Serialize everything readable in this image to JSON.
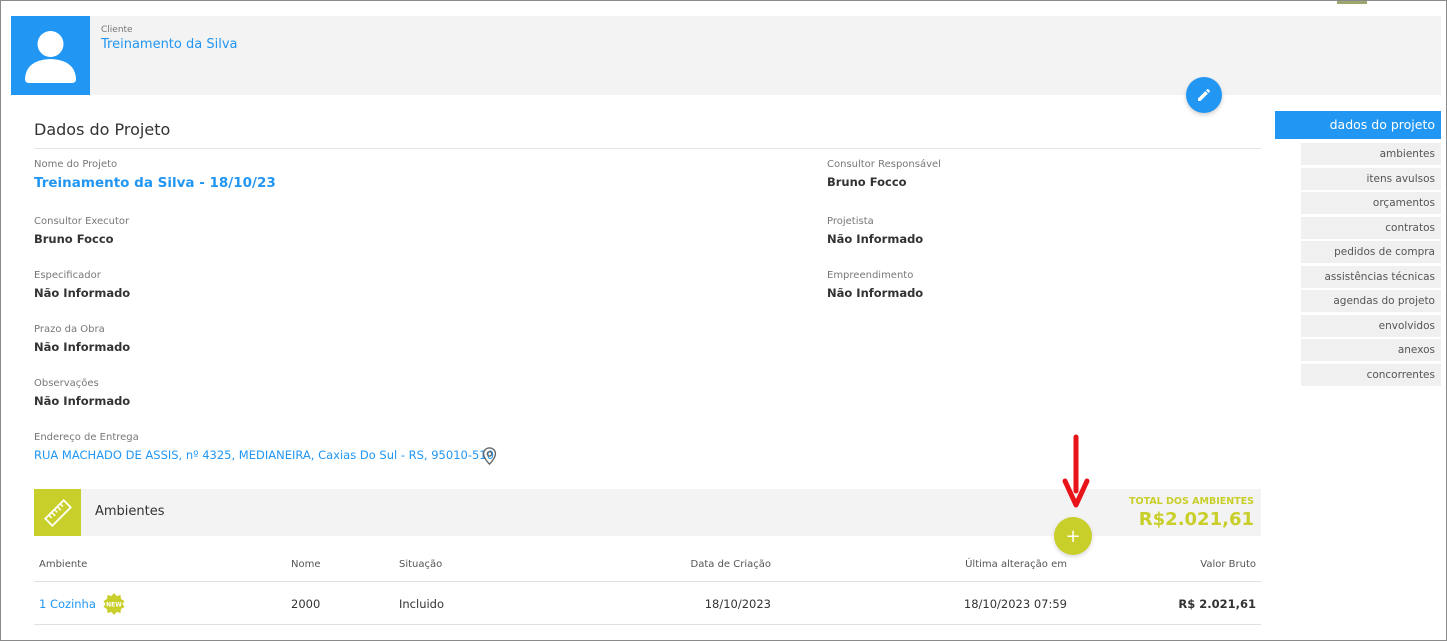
{
  "client": {
    "label": "Cliente",
    "name": "Treinamento da Silva"
  },
  "section": {
    "title": "Dados do Projeto"
  },
  "fields": {
    "nome_projeto": {
      "label": "Nome do Projeto",
      "value": "Treinamento da Silva - 18/10/23"
    },
    "consultor_responsavel": {
      "label": "Consultor Responsável",
      "value": "Bruno Focco"
    },
    "consultor_executor": {
      "label": "Consultor Executor",
      "value": "Bruno Focco"
    },
    "projetista": {
      "label": "Projetista",
      "value": "Não Informado"
    },
    "especificador": {
      "label": "Especificador",
      "value": "Não Informado"
    },
    "empreendimento": {
      "label": "Empreendimento",
      "value": "Não Informado"
    },
    "prazo_obra": {
      "label": "Prazo da Obra",
      "value": "Não Informado"
    },
    "observacoes": {
      "label": "Observações",
      "value": "Não Informado"
    },
    "endereco": {
      "label": "Endereço de Entrega",
      "value": "RUA MACHADO DE ASSIS, nº 4325, MEDIANEIRA, Caxias Do Sul - RS, 95010-510"
    }
  },
  "sidebar": {
    "items": [
      {
        "label": "dados do projeto"
      },
      {
        "label": "ambientes"
      },
      {
        "label": "itens avulsos"
      },
      {
        "label": "orçamentos"
      },
      {
        "label": "contratos"
      },
      {
        "label": "pedidos de compra"
      },
      {
        "label": "assistências técnicas"
      },
      {
        "label": "agendas do projeto"
      },
      {
        "label": "envolvidos"
      },
      {
        "label": "anexos"
      },
      {
        "label": "concorrentes"
      }
    ]
  },
  "ambientes": {
    "title": "Ambientes",
    "total_label": "TOTAL DOS AMBIENTES",
    "total_value": "R$2.021,61",
    "add_label": "+",
    "columns": [
      "Ambiente",
      "Nome",
      "Situação",
      "Data de Criação",
      "Última alteração em",
      "Valor Bruto"
    ],
    "rows": [
      {
        "ambiente": "1 Cozinha",
        "badge": "NEW",
        "nome": "2000",
        "situacao": "Incluido",
        "data_criacao": "18/10/2023",
        "ultima_alteracao": "18/10/2023 07:59",
        "valor_bruto": "R$ 2.021,61"
      }
    ]
  },
  "colors": {
    "primary": "#2196f3",
    "accent": "#c9cf2a",
    "annotation": "#e8141a"
  },
  "icons": {
    "avatar": "user-silhouette-icon",
    "edit": "pencil-icon",
    "location": "map-pin-icon",
    "ambientes": "ruler-icon",
    "annotation": "red-arrow-icon"
  }
}
